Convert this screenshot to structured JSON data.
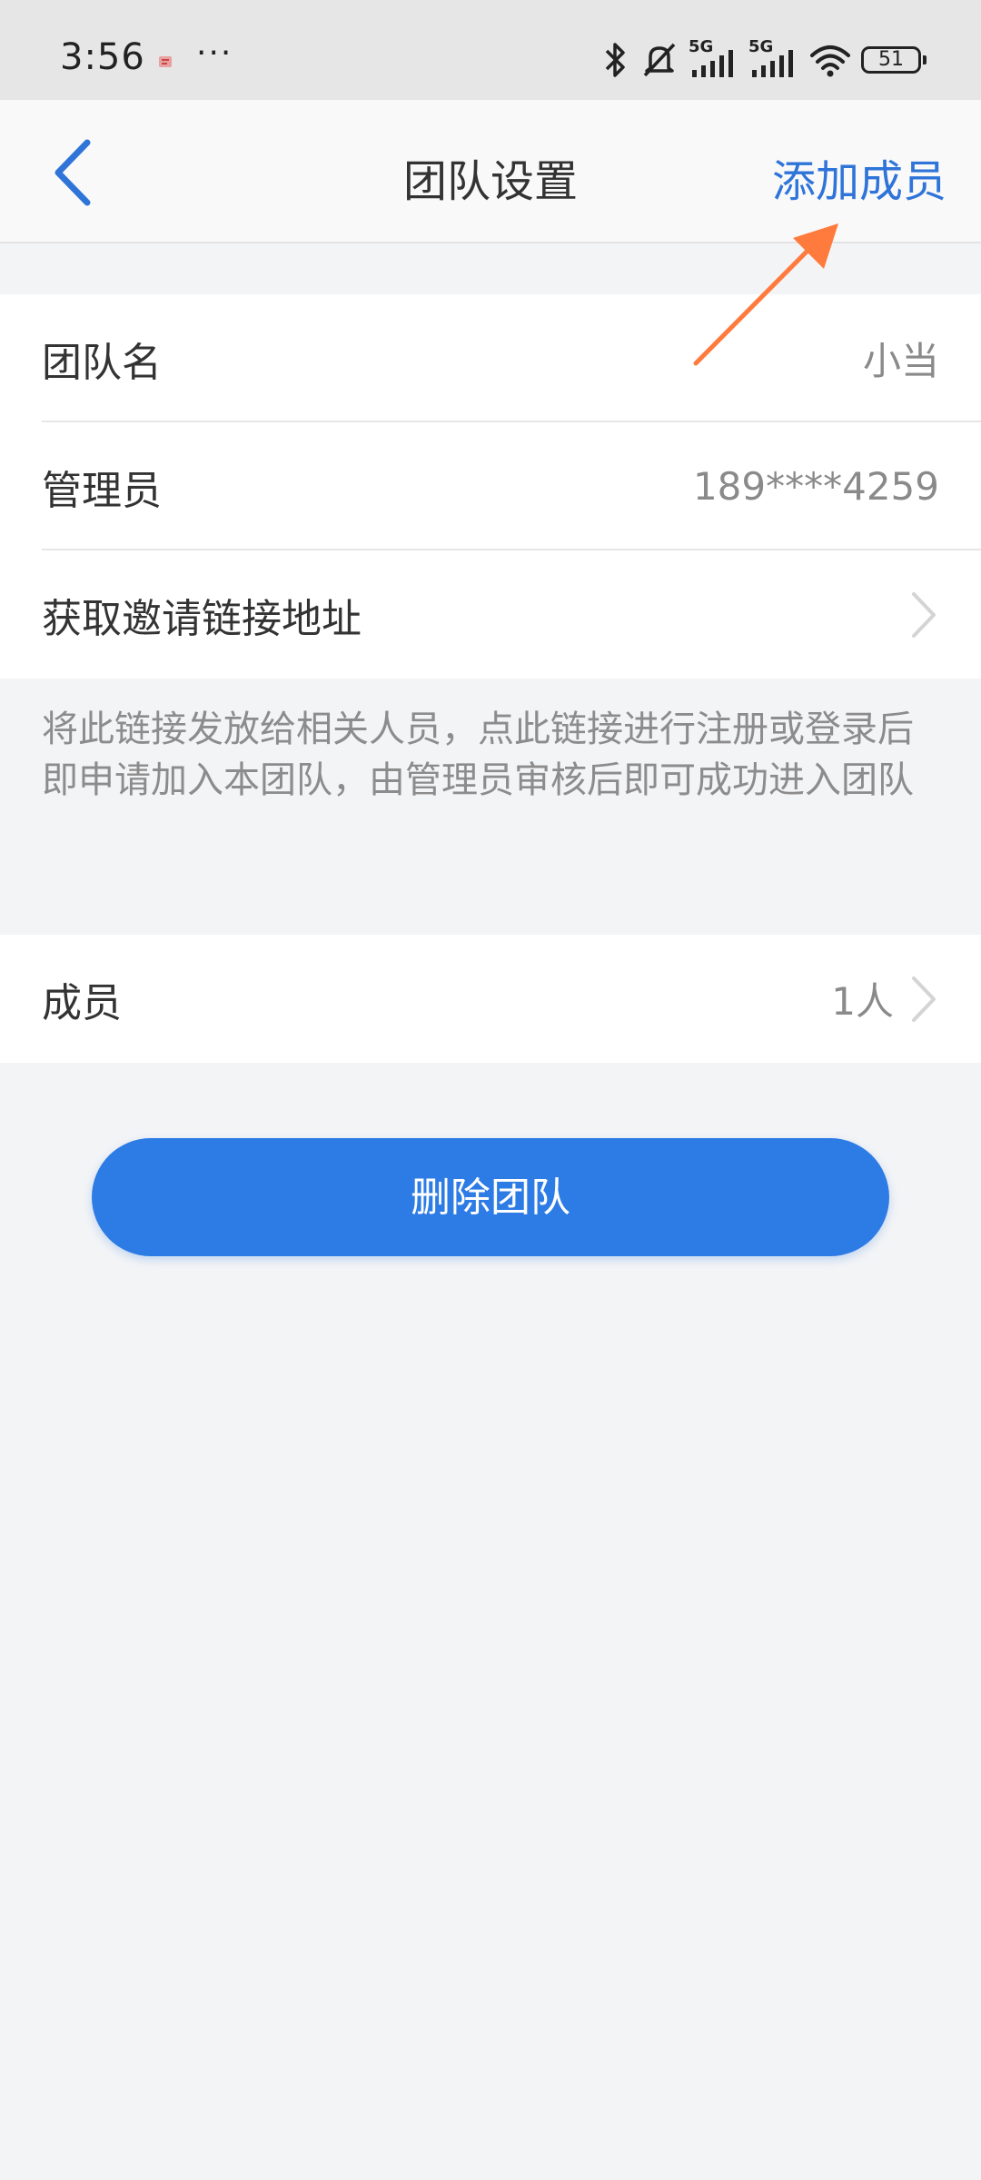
{
  "status_bar": {
    "time": "3:56",
    "dots": "···",
    "network_1": "5G",
    "network_2": "5G",
    "battery": "51"
  },
  "nav": {
    "title": "团队设置",
    "action": "添加成员"
  },
  "team_info": {
    "name_label": "团队名",
    "name_value": "小当",
    "admin_label": "管理员",
    "admin_value": "189****4259",
    "invite_label": "获取邀请链接地址"
  },
  "hint": "将此链接发放给相关人员，点此链接进行注册或登录后即申请加入本团队，由管理员审核后即可成功进入团队",
  "members": {
    "label": "成员",
    "count": "1人"
  },
  "delete_button": "删除团队",
  "colors": {
    "accent": "#2d7be5",
    "link": "#2f74d8",
    "annotation": "#ff7a3d",
    "background": "#f3f4f6"
  }
}
